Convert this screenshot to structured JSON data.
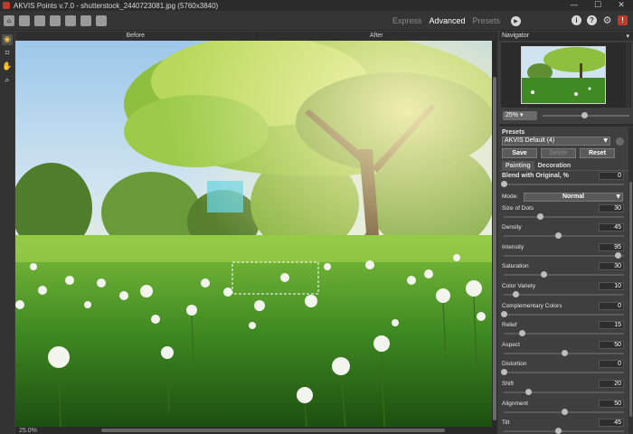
{
  "window": {
    "title": "AKVIS Points v.7.0 - shutterstock_2440723081.jpg (5760x3840)",
    "min": "—",
    "max": "☐",
    "close": "✕"
  },
  "toolbar": {
    "icons": [
      "home-icon",
      "open-file-icon",
      "save-file-icon",
      "print-icon",
      "batch-icon",
      "share-icon",
      "settings-icon"
    ],
    "modes": {
      "express": "Express",
      "advanced": "Advanced",
      "presets": "Presets"
    },
    "active_mode": "advanced",
    "right": {
      "about": "i",
      "help": "?",
      "settings": "⚙",
      "close": "!"
    }
  },
  "tools": [
    {
      "name": "eye-tool",
      "glyph": "◉",
      "active": true
    },
    {
      "name": "crop-tool",
      "glyph": "⌗"
    },
    {
      "name": "hand-tool",
      "glyph": "✋"
    },
    {
      "name": "zoom-tool",
      "glyph": "⌕"
    }
  ],
  "view_tabs": {
    "before": "Before",
    "after": "After"
  },
  "status": {
    "zoom": "25.0%"
  },
  "navigator": {
    "header": "Navigator",
    "zoom": "25% ▾",
    "zoom_fraction": 0.45
  },
  "presets": {
    "label": "Presets",
    "selected": "AKVIS Default (4)",
    "save": "Save",
    "delete": "Delete",
    "reset": "Reset"
  },
  "subtabs": {
    "painting": "Painting",
    "decoration": "Decoration"
  },
  "blend": {
    "label": "Blend with Original, %",
    "value": "0",
    "fraction": 0
  },
  "mode": {
    "label": "Mode:",
    "value": "Normal"
  },
  "params": [
    {
      "label": "Size of Dots",
      "value": "30",
      "fraction": 0.3
    },
    {
      "label": "Density",
      "value": "45",
      "fraction": 0.45
    },
    {
      "label": "Intensity",
      "value": "95",
      "fraction": 0.95
    },
    {
      "label": "Saturation",
      "value": "30",
      "fraction": 0.33
    },
    {
      "label": "Color Variety",
      "value": "10",
      "fraction": 0.1
    },
    {
      "label": "Complementary Colors",
      "value": "0",
      "fraction": 0
    },
    {
      "label": "Relief",
      "value": "15",
      "fraction": 0.15
    },
    {
      "label": "Aspect",
      "value": "50",
      "fraction": 0.5
    },
    {
      "label": "Distortion",
      "value": "0",
      "fraction": 0
    },
    {
      "label": "Shift",
      "value": "20",
      "fraction": 0.2
    },
    {
      "label": "Alignment",
      "value": "50",
      "fraction": 0.5
    },
    {
      "label": "Tilt",
      "value": "45",
      "fraction": 0.45
    }
  ]
}
